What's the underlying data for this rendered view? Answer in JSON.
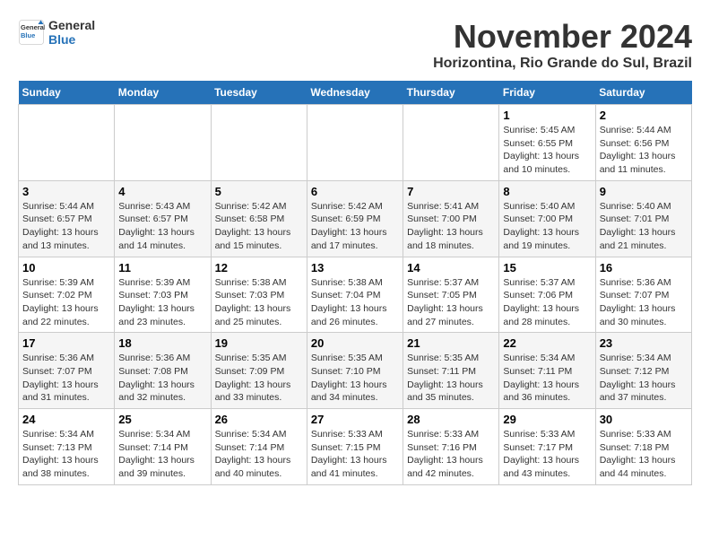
{
  "header": {
    "logo_line1": "General",
    "logo_line2": "Blue",
    "month_title": "November 2024",
    "location": "Horizontina, Rio Grande do Sul, Brazil"
  },
  "weekdays": [
    "Sunday",
    "Monday",
    "Tuesday",
    "Wednesday",
    "Thursday",
    "Friday",
    "Saturday"
  ],
  "weeks": [
    [
      {
        "day": "",
        "info": ""
      },
      {
        "day": "",
        "info": ""
      },
      {
        "day": "",
        "info": ""
      },
      {
        "day": "",
        "info": ""
      },
      {
        "day": "",
        "info": ""
      },
      {
        "day": "1",
        "info": "Sunrise: 5:45 AM\nSunset: 6:55 PM\nDaylight: 13 hours and 10 minutes."
      },
      {
        "day": "2",
        "info": "Sunrise: 5:44 AM\nSunset: 6:56 PM\nDaylight: 13 hours and 11 minutes."
      }
    ],
    [
      {
        "day": "3",
        "info": "Sunrise: 5:44 AM\nSunset: 6:57 PM\nDaylight: 13 hours and 13 minutes."
      },
      {
        "day": "4",
        "info": "Sunrise: 5:43 AM\nSunset: 6:57 PM\nDaylight: 13 hours and 14 minutes."
      },
      {
        "day": "5",
        "info": "Sunrise: 5:42 AM\nSunset: 6:58 PM\nDaylight: 13 hours and 15 minutes."
      },
      {
        "day": "6",
        "info": "Sunrise: 5:42 AM\nSunset: 6:59 PM\nDaylight: 13 hours and 17 minutes."
      },
      {
        "day": "7",
        "info": "Sunrise: 5:41 AM\nSunset: 7:00 PM\nDaylight: 13 hours and 18 minutes."
      },
      {
        "day": "8",
        "info": "Sunrise: 5:40 AM\nSunset: 7:00 PM\nDaylight: 13 hours and 19 minutes."
      },
      {
        "day": "9",
        "info": "Sunrise: 5:40 AM\nSunset: 7:01 PM\nDaylight: 13 hours and 21 minutes."
      }
    ],
    [
      {
        "day": "10",
        "info": "Sunrise: 5:39 AM\nSunset: 7:02 PM\nDaylight: 13 hours and 22 minutes."
      },
      {
        "day": "11",
        "info": "Sunrise: 5:39 AM\nSunset: 7:03 PM\nDaylight: 13 hours and 23 minutes."
      },
      {
        "day": "12",
        "info": "Sunrise: 5:38 AM\nSunset: 7:03 PM\nDaylight: 13 hours and 25 minutes."
      },
      {
        "day": "13",
        "info": "Sunrise: 5:38 AM\nSunset: 7:04 PM\nDaylight: 13 hours and 26 minutes."
      },
      {
        "day": "14",
        "info": "Sunrise: 5:37 AM\nSunset: 7:05 PM\nDaylight: 13 hours and 27 minutes."
      },
      {
        "day": "15",
        "info": "Sunrise: 5:37 AM\nSunset: 7:06 PM\nDaylight: 13 hours and 28 minutes."
      },
      {
        "day": "16",
        "info": "Sunrise: 5:36 AM\nSunset: 7:07 PM\nDaylight: 13 hours and 30 minutes."
      }
    ],
    [
      {
        "day": "17",
        "info": "Sunrise: 5:36 AM\nSunset: 7:07 PM\nDaylight: 13 hours and 31 minutes."
      },
      {
        "day": "18",
        "info": "Sunrise: 5:36 AM\nSunset: 7:08 PM\nDaylight: 13 hours and 32 minutes."
      },
      {
        "day": "19",
        "info": "Sunrise: 5:35 AM\nSunset: 7:09 PM\nDaylight: 13 hours and 33 minutes."
      },
      {
        "day": "20",
        "info": "Sunrise: 5:35 AM\nSunset: 7:10 PM\nDaylight: 13 hours and 34 minutes."
      },
      {
        "day": "21",
        "info": "Sunrise: 5:35 AM\nSunset: 7:11 PM\nDaylight: 13 hours and 35 minutes."
      },
      {
        "day": "22",
        "info": "Sunrise: 5:34 AM\nSunset: 7:11 PM\nDaylight: 13 hours and 36 minutes."
      },
      {
        "day": "23",
        "info": "Sunrise: 5:34 AM\nSunset: 7:12 PM\nDaylight: 13 hours and 37 minutes."
      }
    ],
    [
      {
        "day": "24",
        "info": "Sunrise: 5:34 AM\nSunset: 7:13 PM\nDaylight: 13 hours and 38 minutes."
      },
      {
        "day": "25",
        "info": "Sunrise: 5:34 AM\nSunset: 7:14 PM\nDaylight: 13 hours and 39 minutes."
      },
      {
        "day": "26",
        "info": "Sunrise: 5:34 AM\nSunset: 7:14 PM\nDaylight: 13 hours and 40 minutes."
      },
      {
        "day": "27",
        "info": "Sunrise: 5:33 AM\nSunset: 7:15 PM\nDaylight: 13 hours and 41 minutes."
      },
      {
        "day": "28",
        "info": "Sunrise: 5:33 AM\nSunset: 7:16 PM\nDaylight: 13 hours and 42 minutes."
      },
      {
        "day": "29",
        "info": "Sunrise: 5:33 AM\nSunset: 7:17 PM\nDaylight: 13 hours and 43 minutes."
      },
      {
        "day": "30",
        "info": "Sunrise: 5:33 AM\nSunset: 7:18 PM\nDaylight: 13 hours and 44 minutes."
      }
    ]
  ]
}
